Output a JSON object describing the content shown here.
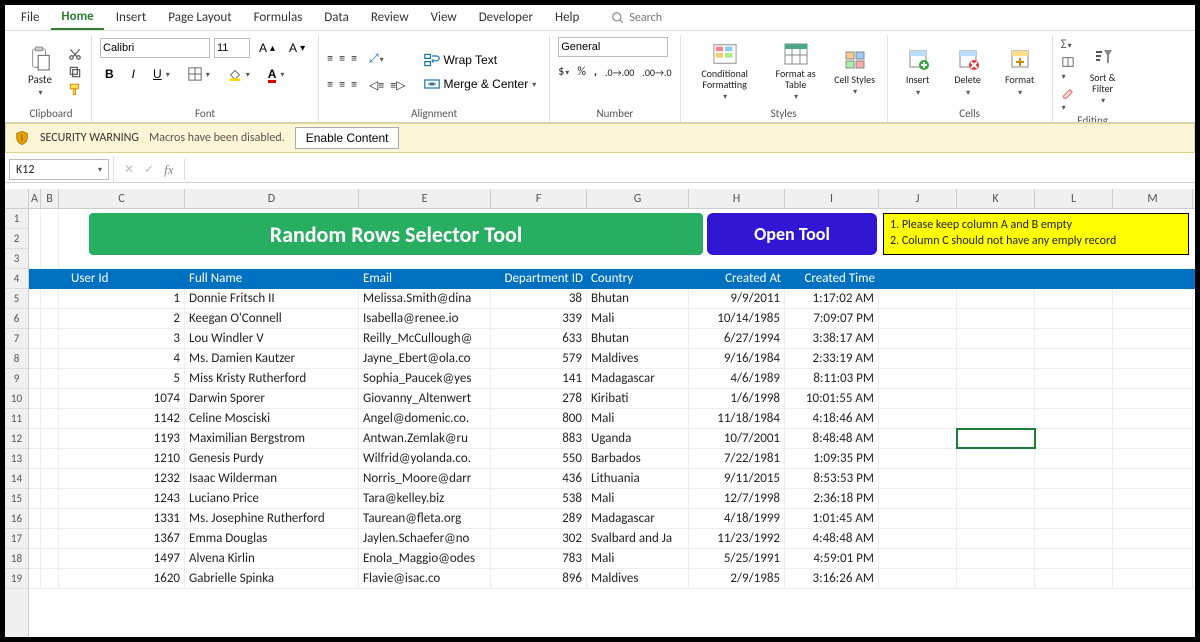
{
  "menu": {
    "tabs": [
      "File",
      "Home",
      "Insert",
      "Page Layout",
      "Formulas",
      "Data",
      "Review",
      "View",
      "Developer",
      "Help"
    ],
    "search": "Search"
  },
  "ribbon": {
    "clipboard": {
      "paste": "Paste",
      "label": "Clipboard"
    },
    "font": {
      "name": "Calibri",
      "size": "11",
      "label": "Font"
    },
    "alignment": {
      "wrap": "Wrap Text",
      "merge": "Merge & Center",
      "label": "Alignment"
    },
    "number": {
      "format": "General",
      "label": "Number"
    },
    "styles": {
      "cond": "Conditional Formatting",
      "fat": "Format as Table",
      "cell": "Cell Styles",
      "label": "Styles"
    },
    "cells": {
      "insert": "Insert",
      "delete": "Delete",
      "format": "Format",
      "label": "Cells"
    },
    "editing": {
      "sort": "Sort & Filter",
      "label": "Editing"
    }
  },
  "security": {
    "title": "SECURITY WARNING",
    "msg": "Macros have been disabled.",
    "button": "Enable Content"
  },
  "namebox": "K12",
  "banner": {
    "title": "Random Rows Selector Tool",
    "button": "Open Tool",
    "note1": "1. Please keep column A and B empty",
    "note2": "2. Column C should not have any emply record"
  },
  "columns": [
    "A",
    "B",
    "C",
    "D",
    "E",
    "F",
    "G",
    "H",
    "I",
    "J",
    "K",
    "L",
    "M"
  ],
  "headers": {
    "c": "User Id",
    "d": "Full Name",
    "e": "Email",
    "f": "Department ID",
    "g": "Country",
    "h": "Created At",
    "i": "Created Time"
  },
  "rows": [
    {
      "id": 1,
      "name": "Donnie Fritsch II",
      "email": "Melissa.Smith@dina",
      "dept": 38,
      "country": "Bhutan",
      "date": "9/9/2011",
      "time": "1:17:02 AM"
    },
    {
      "id": 2,
      "name": "Keegan O'Connell",
      "email": "Isabella@renee.io",
      "dept": 339,
      "country": "Mali",
      "date": "10/14/1985",
      "time": "7:09:07 PM"
    },
    {
      "id": 3,
      "name": "Lou Windler V",
      "email": "Reilly_McCullough@",
      "dept": 633,
      "country": "Bhutan",
      "date": "6/27/1994",
      "time": "3:38:17 AM"
    },
    {
      "id": 4,
      "name": "Ms. Damien Kautzer",
      "email": "Jayne_Ebert@ola.co",
      "dept": 579,
      "country": "Maldives",
      "date": "9/16/1984",
      "time": "2:33:19 AM"
    },
    {
      "id": 5,
      "name": "Miss Kristy Rutherford",
      "email": "Sophia_Paucek@yes",
      "dept": 141,
      "country": "Madagascar",
      "date": "4/6/1989",
      "time": "8:11:03 PM"
    },
    {
      "id": 1074,
      "name": "Darwin Sporer",
      "email": "Giovanny_Altenwert",
      "dept": 278,
      "country": "Kiribati",
      "date": "1/6/1998",
      "time": "10:01:55 AM"
    },
    {
      "id": 1142,
      "name": "Celine Mosciski",
      "email": "Angel@domenic.co.",
      "dept": 800,
      "country": "Mali",
      "date": "11/18/1984",
      "time": "4:18:46 AM"
    },
    {
      "id": 1193,
      "name": "Maximilian Bergstrom",
      "email": "Antwan.Zemlak@ru",
      "dept": 883,
      "country": "Uganda",
      "date": "10/7/2001",
      "time": "8:48:48 AM"
    },
    {
      "id": 1210,
      "name": "Genesis Purdy",
      "email": "Wilfrid@yolanda.co.",
      "dept": 550,
      "country": "Barbados",
      "date": "7/22/1981",
      "time": "1:09:35 PM"
    },
    {
      "id": 1232,
      "name": "Isaac Wilderman",
      "email": "Norris_Moore@darr",
      "dept": 436,
      "country": "Lithuania",
      "date": "9/11/2015",
      "time": "8:53:53 PM"
    },
    {
      "id": 1243,
      "name": "Luciano Price",
      "email": "Tara@kelley.biz",
      "dept": 538,
      "country": "Mali",
      "date": "12/7/1998",
      "time": "2:36:18 PM"
    },
    {
      "id": 1331,
      "name": "Ms. Josephine Rutherford",
      "email": "Taurean@fleta.org",
      "dept": 289,
      "country": "Madagascar",
      "date": "4/18/1999",
      "time": "1:01:45 AM"
    },
    {
      "id": 1367,
      "name": "Emma Douglas",
      "email": "Jaylen.Schaefer@no",
      "dept": 302,
      "country": "Svalbard and Ja",
      "date": "11/23/1992",
      "time": "4:48:48 AM"
    },
    {
      "id": 1497,
      "name": "Alvena Kirlin",
      "email": "Enola_Maggio@odes",
      "dept": 783,
      "country": "Mali",
      "date": "5/25/1991",
      "time": "4:59:01 PM"
    },
    {
      "id": 1620,
      "name": "Gabrielle Spinka",
      "email": "Flavie@isac.co",
      "dept": 896,
      "country": "Maldives",
      "date": "2/9/1985",
      "time": "3:16:26 AM"
    }
  ],
  "selectedCell": "K12"
}
